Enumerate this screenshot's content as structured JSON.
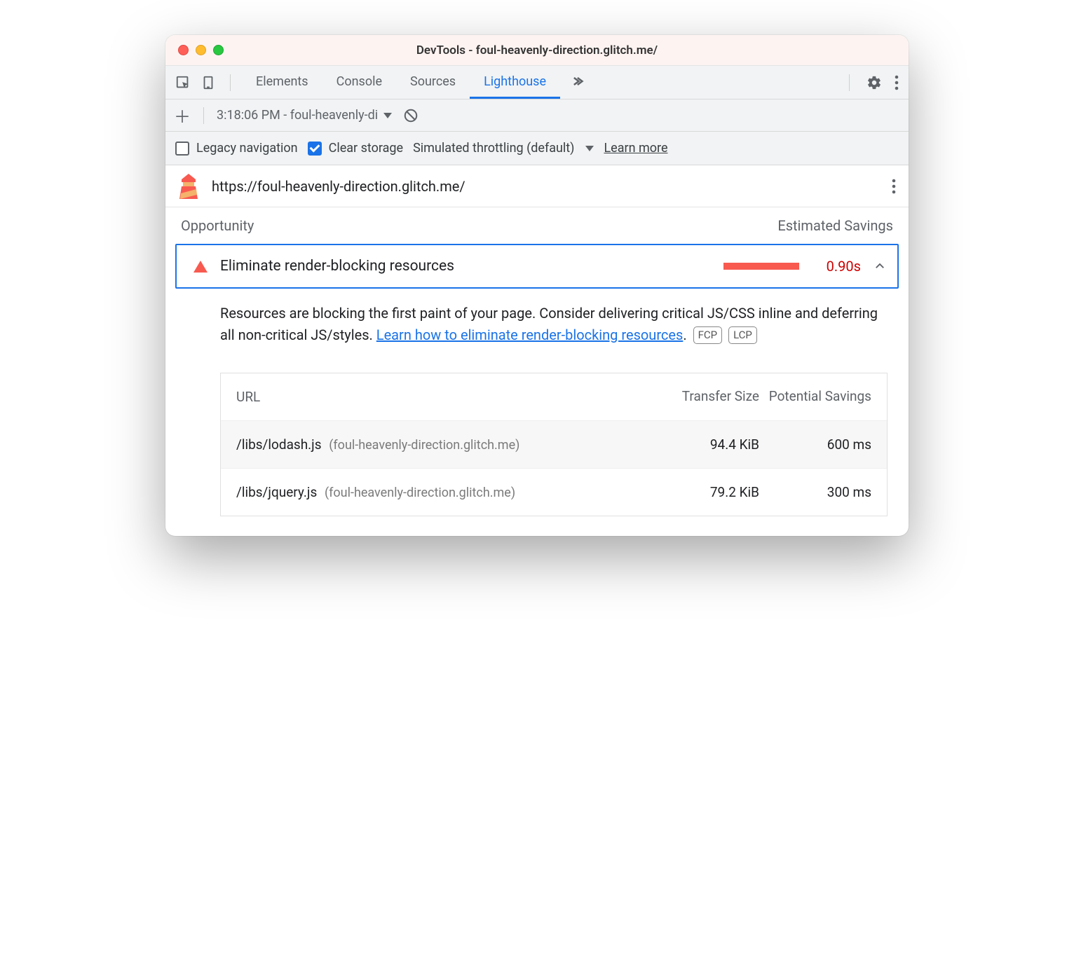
{
  "window": {
    "title": "DevTools - foul-heavenly-direction.glitch.me/"
  },
  "tabs": {
    "items": [
      "Elements",
      "Console",
      "Sources",
      "Lighthouse"
    ],
    "active": "Lighthouse"
  },
  "subtoolbar": {
    "report_label": "3:18:06 PM - foul-heavenly-di"
  },
  "options": {
    "legacy_label": "Legacy navigation",
    "legacy_checked": false,
    "clear_label": "Clear storage",
    "clear_checked": true,
    "throttling_label": "Simulated throttling (default)",
    "learn_more": "Learn more"
  },
  "url_row": {
    "url": "https://foul-heavenly-direction.glitch.me/"
  },
  "opportunity": {
    "left_header": "Opportunity",
    "right_header": "Estimated Savings",
    "audit_title": "Eliminate render-blocking resources",
    "audit_value": "0.90s",
    "desc_pre": "Resources are blocking the first paint of your page. Consider delivering critical JS/CSS inline and deferring all non-critical JS/styles. ",
    "desc_link": "Learn how to eliminate render-blocking resources",
    "desc_post": ".",
    "badge1": "FCP",
    "badge2": "LCP"
  },
  "table": {
    "head_url": "URL",
    "head_size": "Transfer Size",
    "head_savings": "Potential Savings",
    "rows": [
      {
        "path": "/libs/lodash.js",
        "host": "(foul-heavenly-direction.glitch.me)",
        "size": "94.4 KiB",
        "savings": "600 ms"
      },
      {
        "path": "/libs/jquery.js",
        "host": "(foul-heavenly-direction.glitch.me)",
        "size": "79.2 KiB",
        "savings": "300 ms"
      }
    ]
  }
}
